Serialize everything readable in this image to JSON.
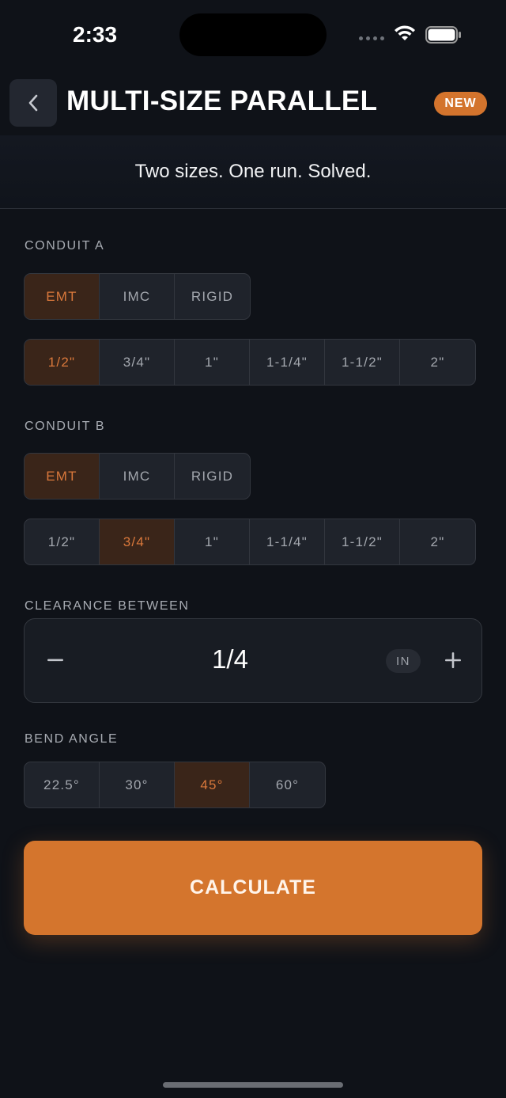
{
  "status": {
    "time": "2:33"
  },
  "header": {
    "title": "MULTI-SIZE PARALLEL",
    "badge": "NEW",
    "tagline": "Two sizes. One run. Solved."
  },
  "conduit_a": {
    "label": "CONDUIT A",
    "types": [
      "EMT",
      "IMC",
      "RIGID"
    ],
    "selected_type": "EMT",
    "sizes": [
      "1/2\"",
      "3/4\"",
      "1\"",
      "1-1/4\"",
      "1-1/2\"",
      "2\""
    ],
    "selected_size": "1/2\""
  },
  "conduit_b": {
    "label": "CONDUIT B",
    "types": [
      "EMT",
      "IMC",
      "RIGID"
    ],
    "selected_type": "EMT",
    "sizes": [
      "1/2\"",
      "3/4\"",
      "1\"",
      "1-1/4\"",
      "1-1/2\"",
      "2\""
    ],
    "selected_size": "3/4\""
  },
  "clearance": {
    "label": "CLEARANCE BETWEEN",
    "value": "1/4",
    "unit": "IN"
  },
  "bend_angle": {
    "label": "BEND ANGLE",
    "options": [
      "22.5°",
      "30°",
      "45°",
      "60°"
    ],
    "selected": "45°"
  },
  "actions": {
    "calculate": "CALCULATE"
  },
  "colors": {
    "accent": "#d4752d",
    "background": "#0f1218",
    "selected_bg": "#3a2519"
  },
  "icons": [
    "chevron-left-icon",
    "wifi-icon",
    "battery-icon",
    "minus-icon",
    "plus-icon"
  ]
}
